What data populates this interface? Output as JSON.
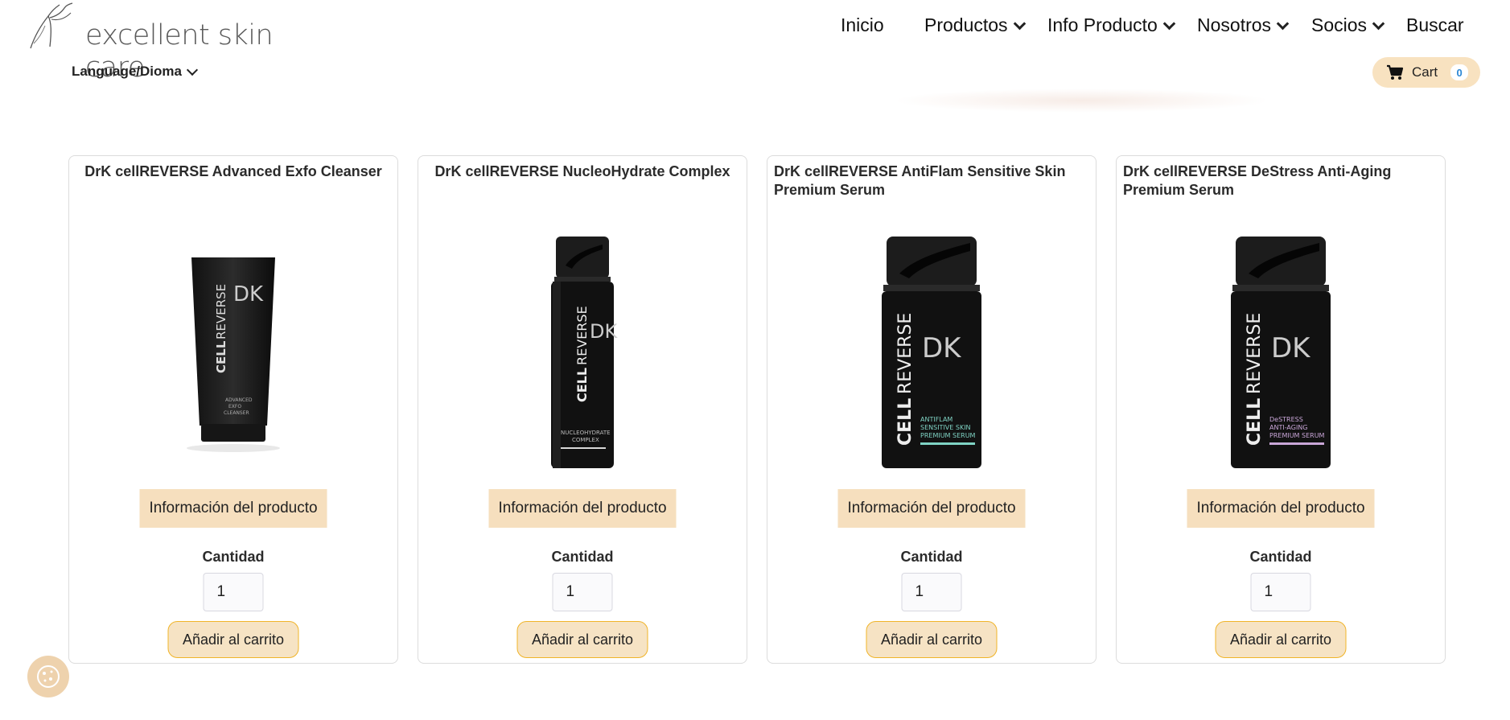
{
  "header": {
    "logo_text": "excellent skin care",
    "language_label": "Language/Dioma",
    "nav": [
      {
        "label": "Inicio"
      },
      {
        "label": "Productos"
      },
      {
        "label": "Info Producto"
      },
      {
        "label": "Nosotros"
      },
      {
        "label": "Socios"
      },
      {
        "label": "Buscar"
      }
    ],
    "cart": {
      "label": "Cart",
      "count": "0"
    }
  },
  "products": [
    {
      "title": "DrK cellREVERSE Advanced Exfo Cleanser",
      "info_button": "Información del producto",
      "quantity_label": "Cantidad",
      "quantity_value": "1",
      "add_button": "Añadir al carrito",
      "package": "tube",
      "brand_mark": "CELLREVERSE",
      "sub_label": "ADVANCED EXFO CLEANSER",
      "accent_color": "#9a9a9a"
    },
    {
      "title": "DrK cellREVERSE NucleoHydrate Complex",
      "info_button": "Información del producto",
      "quantity_label": "Cantidad",
      "quantity_value": "1",
      "add_button": "Añadir al carrito",
      "package": "pump-slim",
      "brand_mark": "CELLREVERSE",
      "sub_label": "NUCLEOHYDRATE COMPLEX",
      "accent_color": "#d8d8d8"
    },
    {
      "title": "DrK cellREVERSE AntiFlam Sensitive Skin Premium Serum",
      "info_button": "Información del producto",
      "quantity_label": "Cantidad",
      "quantity_value": "1",
      "add_button": "Añadir al carrito",
      "package": "pump-wide",
      "brand_mark": "CELLREVERSE",
      "sub_label": "ANTIFLAM SENSITIVE SKIN PREMIUM SERUM",
      "accent_color": "#7fd3c4"
    },
    {
      "title": "DrK cellREVERSE DeStress Anti-Aging Premium Serum",
      "info_button": "Información del producto",
      "quantity_label": "Cantidad",
      "quantity_value": "1",
      "add_button": "Añadir al carrito",
      "package": "pump-wide",
      "brand_mark": "CELLREVERSE",
      "sub_label": "DeSTRESS ANTI-AGING PREMIUM SERUM",
      "accent_color": "#c9a6d8"
    }
  ],
  "colors": {
    "accent": "#f6dfbe",
    "button_border": "#f0b429",
    "cart_count": "#2a86d4"
  }
}
